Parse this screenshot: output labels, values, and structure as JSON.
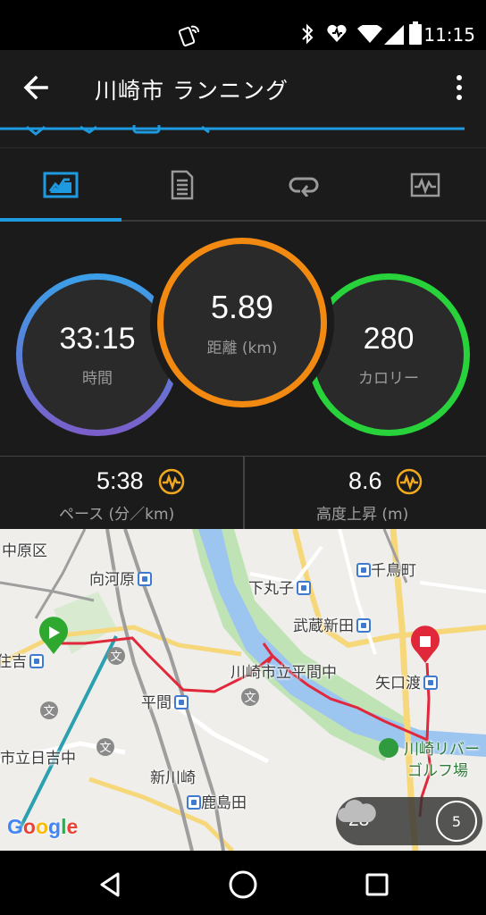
{
  "status_bar": {
    "time": "11:15"
  },
  "app_bar": {
    "title": "川崎市 ランニング"
  },
  "tabs": [
    {
      "name": "overview",
      "icon": "summary-chart-icon",
      "active": true
    },
    {
      "name": "details",
      "icon": "document-icon",
      "active": false
    },
    {
      "name": "laps",
      "icon": "loop-icon",
      "active": false
    },
    {
      "name": "graphs",
      "icon": "graph-icon",
      "active": false
    }
  ],
  "stats": {
    "time": {
      "value": "33:15",
      "label": "時間"
    },
    "distance": {
      "value": "5.89",
      "label": "距離 (km)"
    },
    "calories": {
      "value": "280",
      "label": "カロリー"
    }
  },
  "metrics": {
    "pace": {
      "value": "5:38",
      "label": "ペース (分／km)"
    },
    "elevation": {
      "value": "8.6",
      "label": "高度上昇 (m)"
    }
  },
  "map": {
    "labels": {
      "nakahara": "中原区",
      "mukaigawara": "向河原",
      "shimomaruko": "下丸子",
      "chidoricho": "千鳥町",
      "musashinitta": "武蔵新田",
      "yaguchinowatashi": "矢口渡",
      "hirama_school": "川崎市立平間中",
      "hirama": "平間",
      "kawasaki_river_golf_1": "川崎リバー",
      "kawasaki_river_golf_2": "ゴルフ場",
      "hiyoshi": "市立日吉中",
      "shinkawasaki": "新川崎",
      "kashimada": "鹿島田",
      "sumiyoshi": "住吉",
      "school_mark": "文"
    },
    "google": "Google",
    "weather": {
      "temp": "28°",
      "wind": "5"
    }
  },
  "colors": {
    "accent_blue": "#1e9ae0",
    "distance_orange": "#f28a12",
    "calorie_green": "#28d23a",
    "route_red": "#e0283a"
  }
}
